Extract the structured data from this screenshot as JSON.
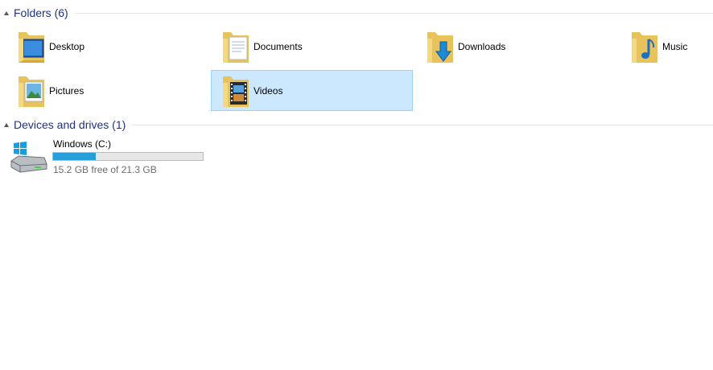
{
  "folders_group": {
    "title": "Folders (6)"
  },
  "folders": [
    {
      "label": "Desktop",
      "icon": "desktop-folder-icon"
    },
    {
      "label": "Documents",
      "icon": "documents-folder-icon"
    },
    {
      "label": "Downloads",
      "icon": "downloads-folder-icon"
    },
    {
      "label": "Music",
      "icon": "music-folder-icon"
    },
    {
      "label": "Pictures",
      "icon": "pictures-folder-icon"
    },
    {
      "label": "Videos",
      "icon": "videos-folder-icon",
      "selected": true
    }
  ],
  "drives_group": {
    "title": "Devices and drives (1)"
  },
  "drives": [
    {
      "name": "Windows (C:)",
      "free_text": "15.2 GB free of 21.3 GB",
      "used_fraction": 0.286,
      "icon": "hard-drive-icon"
    }
  ],
  "colors": {
    "selection": "#cce8ff",
    "selection_border": "#99d1ff",
    "bar_fill": "#26a0da",
    "header_text": "#1e3287"
  }
}
